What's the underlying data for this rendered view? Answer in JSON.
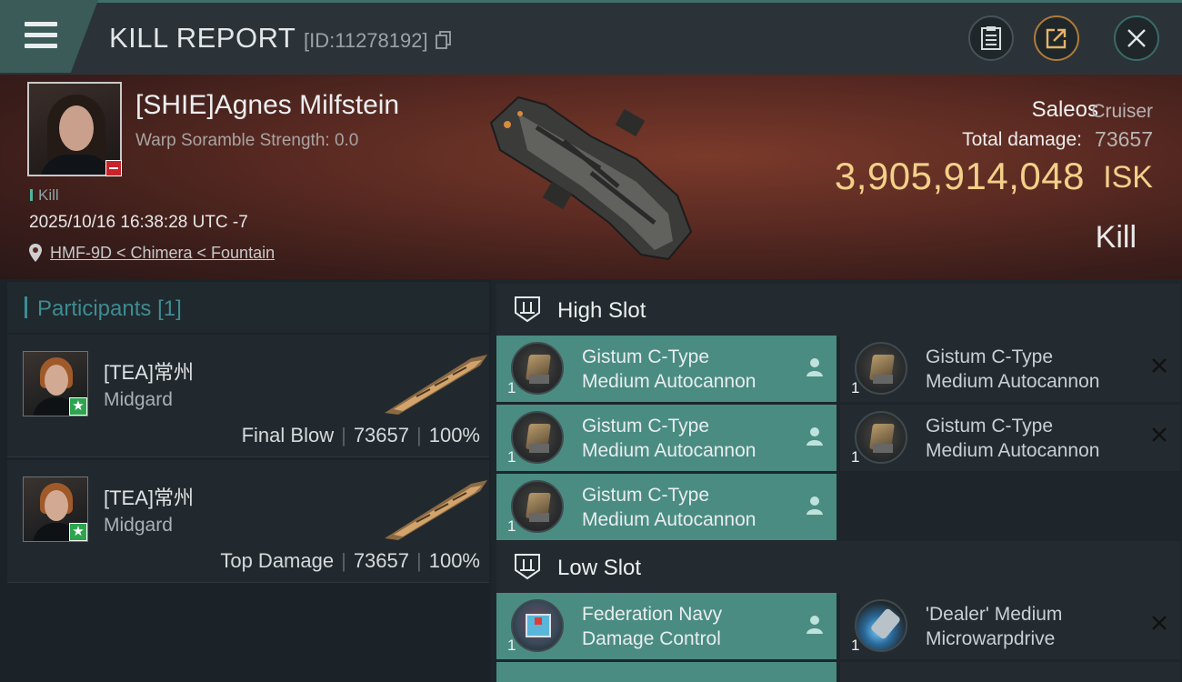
{
  "header": {
    "title": "KILL REPORT",
    "report_id": "[ID:11278192]",
    "icons": [
      "menu-icon",
      "copy-icon",
      "clipboard-icon",
      "share-icon",
      "close-icon"
    ]
  },
  "victim": {
    "name": "[SHIE]Agnes Milfstein",
    "scramble": "Warp Soramble Strength: 0.0",
    "tag": "Kill",
    "datetime": "2025/10/16 16:38:28 UTC -7",
    "location": "HMF-9D < Chimera < Fountain",
    "ship_name": "Saleos",
    "ship_class": "Cruiser",
    "damage_label": "Total damage:",
    "damage_value": "73657",
    "isk_value": "3,905,914,048",
    "isk_unit": "ISK",
    "result": "Kill"
  },
  "participants": {
    "title": "Participants",
    "count": "[1]",
    "items": [
      {
        "name": "[TEA]常州",
        "corp": "Midgard",
        "role": "Final Blow",
        "damage": "73657",
        "percent": "100%"
      },
      {
        "name": "[TEA]常州",
        "corp": "Midgard",
        "role": "Top Damage",
        "damage": "73657",
        "percent": "100%"
      }
    ]
  },
  "high_slot": {
    "title": "High Slot",
    "modules": [
      {
        "line1": "Gistum C-Type",
        "line2": "Medium Autocannon",
        "qty": "1",
        "state": "fitted"
      },
      {
        "line1": "Gistum C-Type",
        "line2": "Medium Autocannon",
        "qty": "1",
        "state": "destroyed"
      },
      {
        "line1": "Gistum C-Type",
        "line2": "Medium Autocannon",
        "qty": "1",
        "state": "fitted"
      },
      {
        "line1": "Gistum C-Type",
        "line2": "Medium Autocannon",
        "qty": "1",
        "state": "destroyed"
      },
      {
        "line1": "Gistum C-Type",
        "line2": "Medium Autocannon",
        "qty": "1",
        "state": "fitted"
      }
    ]
  },
  "low_slot": {
    "title": "Low Slot",
    "modules": [
      {
        "line1": "Federation Navy",
        "line2": "Damage Control",
        "qty": "1",
        "state": "fitted"
      },
      {
        "line1": "'Dealer' Medium",
        "line2": "Microwarpdrive",
        "qty": "1",
        "state": "destroyed"
      }
    ]
  },
  "colors": {
    "accent_teal": "#4a8c82",
    "isk_gold": "#f3d08a",
    "banner_red": "#5a2a22"
  }
}
